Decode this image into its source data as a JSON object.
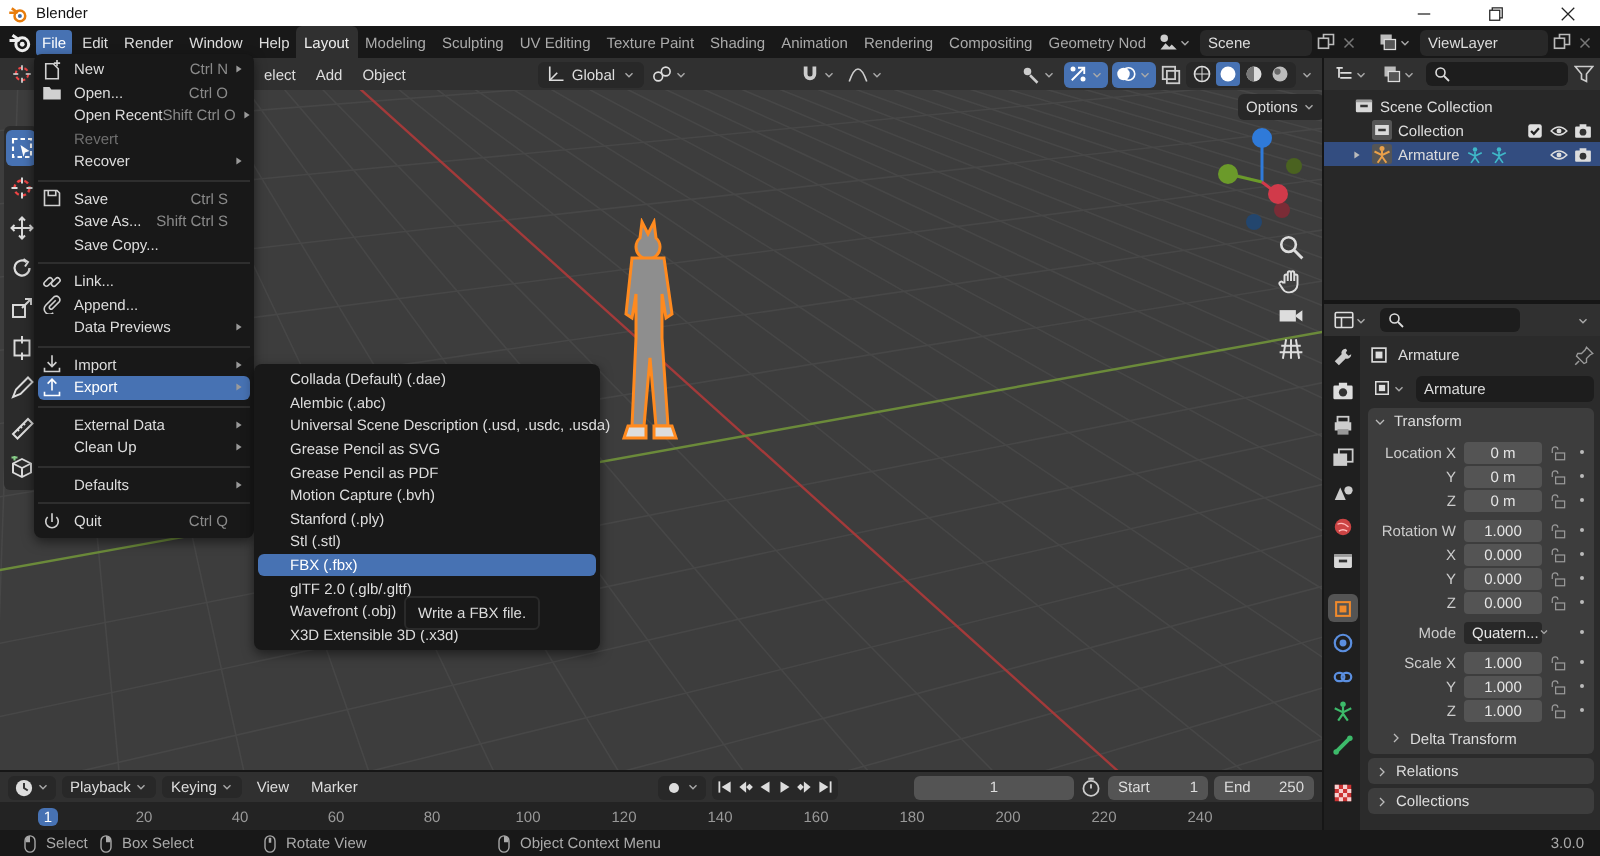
{
  "window": {
    "title": "Blender"
  },
  "menubar": [
    {
      "label": "File",
      "selected": true
    },
    {
      "label": "Edit",
      "selected": false
    },
    {
      "label": "Render",
      "selected": false
    },
    {
      "label": "Window",
      "selected": false
    },
    {
      "label": "Help",
      "selected": false
    }
  ],
  "workspaces": [
    {
      "label": "Layout",
      "selected": true
    },
    {
      "label": "Modeling",
      "selected": false
    },
    {
      "label": "Sculpting",
      "selected": false
    },
    {
      "label": "UV Editing",
      "selected": false
    },
    {
      "label": "Texture Paint",
      "selected": false
    },
    {
      "label": "Shading",
      "selected": false
    },
    {
      "label": "Animation",
      "selected": false
    },
    {
      "label": "Rendering",
      "selected": false
    },
    {
      "label": "Compositing",
      "selected": false
    },
    {
      "label": "Geometry Nod",
      "selected": false
    }
  ],
  "scene_selector": {
    "value": "Scene"
  },
  "view_layer_selector": {
    "value": "ViewLayer"
  },
  "viewport": {
    "menus": [
      "elect",
      "Add",
      "Object"
    ],
    "orientation": "Global",
    "options": "Options",
    "gizmos_on": true,
    "overlays_on": true,
    "shading_modes": [
      {
        "selected": false
      },
      {
        "selected": true
      },
      {
        "selected": false
      },
      {
        "selected": false
      }
    ],
    "toolbar": [
      {
        "selected": true
      },
      {
        "selected": false
      },
      {
        "selected": false
      },
      {
        "selected": false
      },
      {
        "selected": false
      },
      {
        "selected": false
      },
      {
        "selected": false
      },
      {
        "selected": false
      },
      {
        "selected": false
      }
    ]
  },
  "file_menu": {
    "items": [
      {
        "kind": "item",
        "label": "New",
        "shortcut": "Ctrl N",
        "submenu": true,
        "disabled": false,
        "selected": false
      },
      {
        "kind": "item",
        "label": "Open...",
        "shortcut": "Ctrl O",
        "submenu": false,
        "disabled": false,
        "selected": false
      },
      {
        "kind": "item",
        "label": "Open Recent",
        "shortcut": "Shift Ctrl O",
        "submenu": true,
        "disabled": false,
        "selected": false
      },
      {
        "kind": "item",
        "label": "Revert",
        "submenu": false,
        "disabled": true,
        "selected": false
      },
      {
        "kind": "item",
        "label": "Recover",
        "submenu": true,
        "disabled": false,
        "selected": false
      },
      {
        "kind": "separator"
      },
      {
        "kind": "item",
        "label": "Save",
        "shortcut": "Ctrl S",
        "submenu": false,
        "disabled": false,
        "selected": false
      },
      {
        "kind": "item",
        "label": "Save As...",
        "shortcut": "Shift Ctrl S",
        "submenu": false,
        "disabled": false,
        "selected": false
      },
      {
        "kind": "item",
        "label": "Save Copy...",
        "submenu": false,
        "disabled": false,
        "selected": false
      },
      {
        "kind": "separator"
      },
      {
        "kind": "item",
        "label": "Link...",
        "submenu": false,
        "disabled": false,
        "selected": false
      },
      {
        "kind": "item",
        "label": "Append...",
        "submenu": false,
        "disabled": false,
        "selected": false
      },
      {
        "kind": "item",
        "label": "Data Previews",
        "submenu": true,
        "disabled": false,
        "selected": false
      },
      {
        "kind": "separator"
      },
      {
        "kind": "item",
        "label": "Import",
        "submenu": true,
        "disabled": false,
        "selected": false
      },
      {
        "kind": "item",
        "label": "Export",
        "submenu": true,
        "disabled": false,
        "selected": true
      },
      {
        "kind": "separator"
      },
      {
        "kind": "item",
        "label": "External Data",
        "submenu": true,
        "disabled": false,
        "selected": false
      },
      {
        "kind": "item",
        "label": "Clean Up",
        "submenu": true,
        "disabled": false,
        "selected": false
      },
      {
        "kind": "separator"
      },
      {
        "kind": "item",
        "label": "Defaults",
        "submenu": true,
        "disabled": false,
        "selected": false
      },
      {
        "kind": "separator"
      },
      {
        "kind": "item",
        "label": "Quit",
        "shortcut": "Ctrl Q",
        "submenu": false,
        "disabled": false,
        "selected": false
      }
    ]
  },
  "export_menu": {
    "items": [
      {
        "label": "Collada (Default) (.dae)",
        "selected": false
      },
      {
        "label": "Alembic (.abc)",
        "selected": false
      },
      {
        "label": "Universal Scene Description (.usd, .usdc, .usda)",
        "selected": false
      },
      {
        "label": "Grease Pencil as SVG",
        "selected": false
      },
      {
        "label": "Grease Pencil as PDF",
        "selected": false
      },
      {
        "label": "Motion Capture (.bvh)",
        "selected": false
      },
      {
        "label": "Stanford (.ply)",
        "selected": false
      },
      {
        "label": "Stl (.stl)",
        "selected": false
      },
      {
        "label": "FBX (.fbx)",
        "selected": true
      },
      {
        "label": "glTF 2.0 (.glb/.gltf)",
        "selected": false
      },
      {
        "label": "Wavefront (.obj)",
        "selected": false
      },
      {
        "label": "X3D Extensible 3D (.x3d)",
        "selected": false
      }
    ]
  },
  "tooltip": "Write a FBX file.",
  "outliner": {
    "items": [
      {
        "kind": "scene",
        "label": "Scene Collection",
        "children": [
          {
            "kind": "collection",
            "label": "Collection",
            "checked": true,
            "selected": false
          },
          {
            "kind": "object",
            "label": "Armature",
            "expanded": false,
            "selected": true
          }
        ]
      }
    ]
  },
  "properties": {
    "tabs": [
      {
        "selected": false
      },
      {
        "selected": false
      },
      {
        "selected": false
      },
      {
        "selected": false
      },
      {
        "selected": false
      },
      {
        "selected": false
      },
      {
        "selected": false
      },
      {
        "selected": true
      },
      {
        "selected": false
      },
      {
        "selected": false
      },
      {
        "selected": false
      },
      {
        "selected": false
      },
      {
        "selected": false
      }
    ],
    "object_name": "Armature",
    "data_name": "Armature",
    "transform": {
      "title": "Transform",
      "expanded": true,
      "groups": [
        {
          "rows": [
            {
              "kind": "number",
              "label": "Location X",
              "value": "0 m"
            },
            {
              "kind": "number",
              "label": "Y",
              "value": "0 m"
            },
            {
              "kind": "number",
              "label": "Z",
              "value": "0 m"
            }
          ]
        },
        {
          "rows": [
            {
              "kind": "number",
              "label": "Rotation W",
              "value": "1.000"
            },
            {
              "kind": "number",
              "label": "X",
              "value": "0.000"
            },
            {
              "kind": "number",
              "label": "Y",
              "value": "0.000"
            },
            {
              "kind": "number",
              "label": "Z",
              "value": "0.000"
            }
          ]
        },
        {
          "rows": [
            {
              "kind": "dropdown",
              "label": "Mode",
              "value": "Quatern..."
            }
          ]
        },
        {
          "rows": [
            {
              "kind": "number",
              "label": "Scale X",
              "value": "1.000"
            },
            {
              "kind": "number",
              "label": "Y",
              "value": "1.000"
            },
            {
              "kind": "number",
              "label": "Z",
              "value": "1.000"
            }
          ]
        }
      ],
      "subpanels": [
        {
          "title": "Delta Transform",
          "expanded": false
        }
      ]
    },
    "panels": [
      {
        "title": "Relations",
        "expanded": false
      },
      {
        "title": "Collections",
        "expanded": false
      }
    ]
  },
  "timeline": {
    "menus": [
      {
        "label": "Playback",
        "dropdown": true
      },
      {
        "label": "Keying",
        "dropdown": true
      },
      {
        "label": "View",
        "dropdown": false
      },
      {
        "label": "Marker",
        "dropdown": false
      }
    ],
    "current_frame": "1",
    "start_label": "Start",
    "start": "1",
    "end_label": "End",
    "end": "250",
    "ruler": [
      {
        "label": "1",
        "selected": true
      },
      {
        "label": "20",
        "selected": false
      },
      {
        "label": "40",
        "selected": false
      },
      {
        "label": "60",
        "selected": false
      },
      {
        "label": "80",
        "selected": false
      },
      {
        "label": "100",
        "selected": false
      },
      {
        "label": "120",
        "selected": false
      },
      {
        "label": "140",
        "selected": false
      },
      {
        "label": "160",
        "selected": false
      },
      {
        "label": "180",
        "selected": false
      },
      {
        "label": "200",
        "selected": false
      },
      {
        "label": "220",
        "selected": false
      },
      {
        "label": "240",
        "selected": false
      }
    ]
  },
  "status_bar": {
    "hints": [
      "Select",
      "Box Select",
      "Rotate View",
      "Object Context Menu"
    ],
    "version": "3.0.0"
  }
}
